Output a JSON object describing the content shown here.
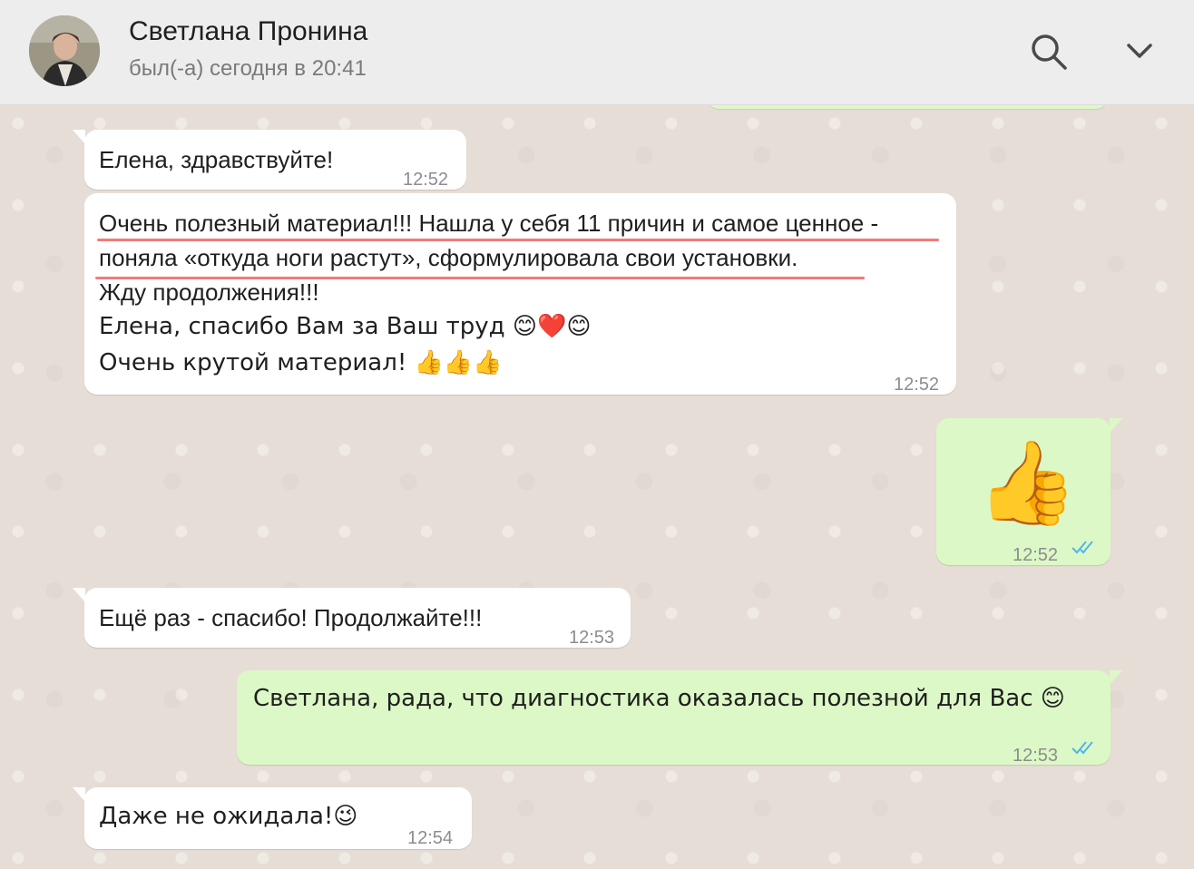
{
  "header": {
    "contact_name": "Светлана Пронина",
    "last_seen": "был(-а) сегодня в 20:41",
    "search_icon": "search-icon",
    "menu_icon": "chevron-down-icon"
  },
  "colors": {
    "incoming_bubble": "#ffffff",
    "outgoing_bubble": "#dcf8c6",
    "read_ticks": "#4fb6ec",
    "underline": "#f27b7b"
  },
  "messages": [
    {
      "direction": "in",
      "lines": [
        "Елена, здравствуйте!"
      ],
      "time": "12:52"
    },
    {
      "direction": "in",
      "lines": [
        "Очень полезный материал!!! Нашла у себя 11 причин и самое ценное -",
        "поняла «откуда ноги растут», сформулировала свои установки.",
        "Жду продолжения!!!",
        "Елена, спасибо Вам за Ваш труд 😊❤️😊",
        "Очень крутой материал! 👍👍👍"
      ],
      "time": "12:52"
    },
    {
      "direction": "out",
      "emoji": "👍",
      "time": "12:52",
      "status": "read"
    },
    {
      "direction": "in",
      "lines": [
        "Ещё раз - спасибо! Продолжайте!!!"
      ],
      "time": "12:53"
    },
    {
      "direction": "out",
      "lines": [
        "Светлана, рада, что диагностика оказалась полезной для Вас 😊"
      ],
      "time": "12:53",
      "status": "read"
    },
    {
      "direction": "in",
      "lines": [
        "Даже не ожидала!😉"
      ],
      "time": "12:54"
    }
  ]
}
